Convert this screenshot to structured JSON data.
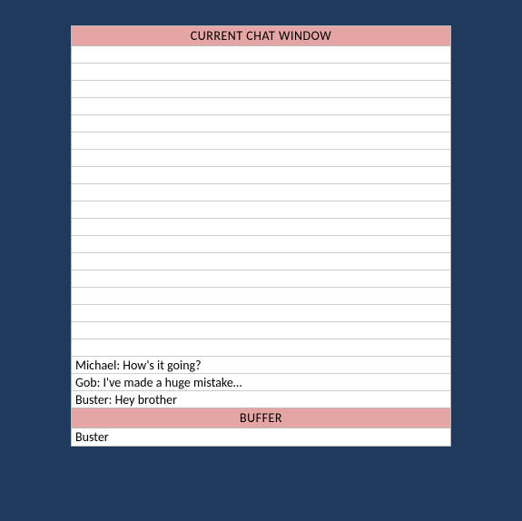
{
  "chat": {
    "header": "CURRENT CHAT WINDOW",
    "rows": [
      "",
      "",
      "",
      "",
      "",
      "",
      "",
      "",
      "",
      "",
      "",
      "",
      "",
      "",
      "",
      "",
      "",
      "",
      "Michael: How's it going?",
      "Gob: I've made a huge mistake…",
      "Buster: Hey brother"
    ]
  },
  "buffer": {
    "header": "BUFFER",
    "rows": [
      "Buster"
    ]
  }
}
